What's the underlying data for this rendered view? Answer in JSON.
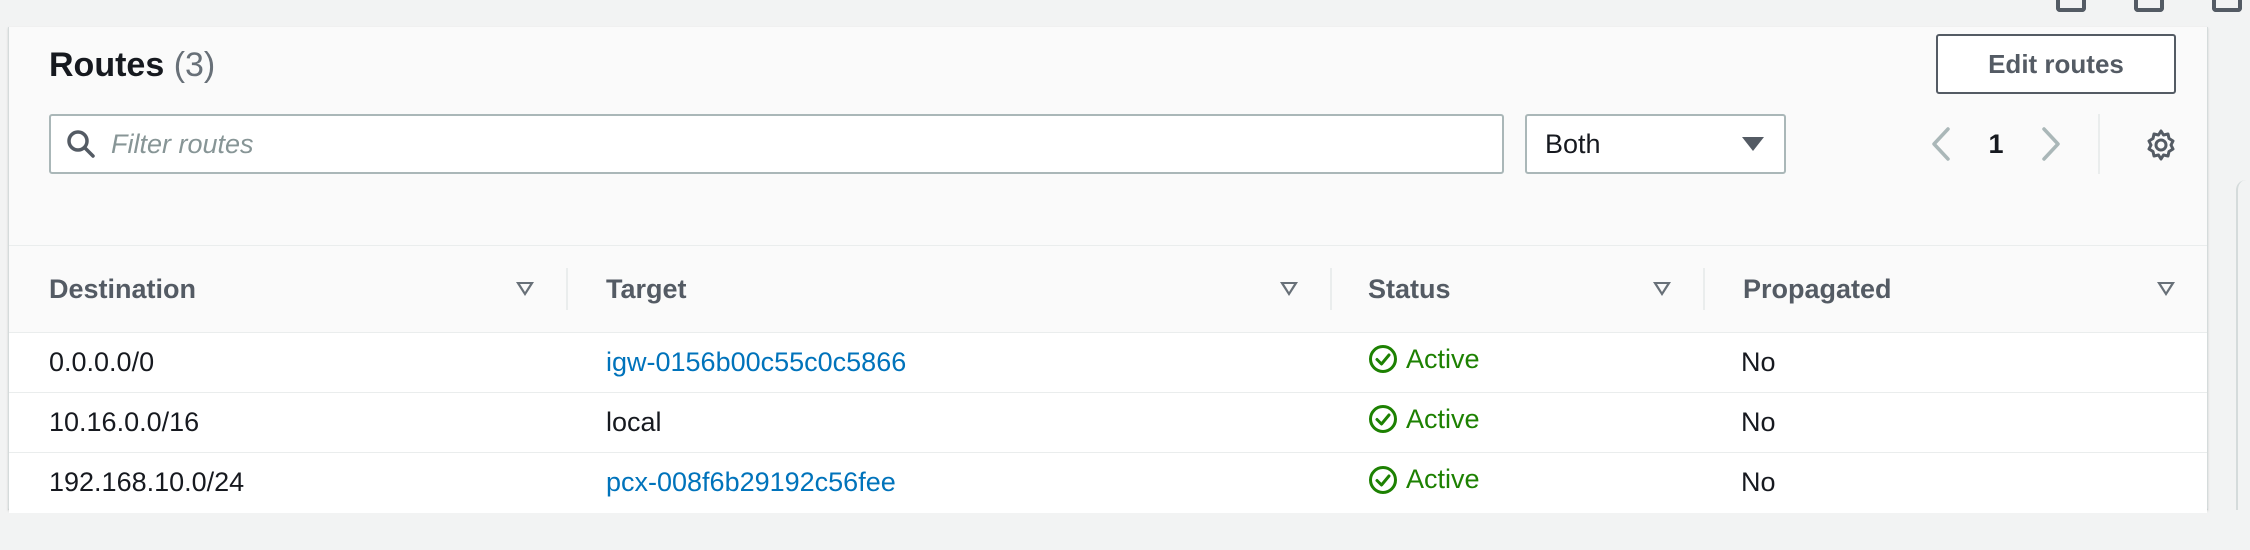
{
  "header": {
    "title": "Routes",
    "count": "(3)",
    "edit_button": "Edit routes"
  },
  "filter": {
    "placeholder": "Filter routes",
    "select_value": "Both"
  },
  "pagination": {
    "current_page": "1"
  },
  "table": {
    "columns": [
      "Destination",
      "Target",
      "Status",
      "Propagated"
    ],
    "rows": [
      {
        "destination": "0.0.0.0/0",
        "target": "igw-0156b00c55c0c5866",
        "target_is_link": true,
        "status": "Active",
        "propagated": "No"
      },
      {
        "destination": "10.16.0.0/16",
        "target": "local",
        "target_is_link": false,
        "status": "Active",
        "propagated": "No"
      },
      {
        "destination": "192.168.10.0/24",
        "target": "pcx-008f6b29192c56fee",
        "target_is_link": true,
        "status": "Active",
        "propagated": "No"
      }
    ]
  },
  "colors": {
    "link": "#0073bb",
    "status_active": "#1d8102",
    "header_text": "#545b64"
  },
  "icons": [
    "search-icon",
    "caret-down-icon",
    "chevron-left-icon",
    "chevron-right-icon",
    "gear-icon",
    "sort-icon",
    "check-circle-icon"
  ]
}
